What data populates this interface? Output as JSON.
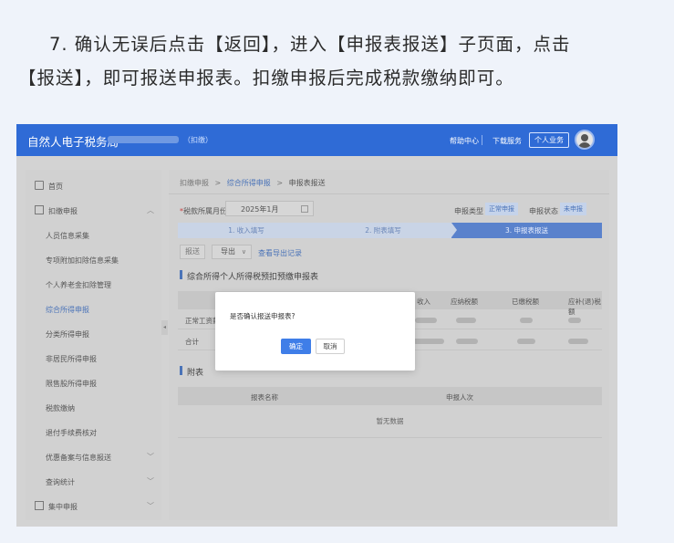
{
  "article": {
    "line1": "7. 确认无误后点击【返回】，进入【申报表报送】子页面，点击",
    "line2": "【报送】，即可报送申报表。扣缴申报后完成税款缴纳即可。"
  },
  "topbar": {
    "brand": "自然人电子税务局",
    "sub": "（扣缴）",
    "help": "帮助中心",
    "download": "下载服务",
    "business": "个人业务"
  },
  "sidebar": {
    "items": [
      {
        "label": "首页"
      },
      {
        "label": "扣缴申报"
      },
      {
        "label": "人员信息采集"
      },
      {
        "label": "专项附加扣除信息采集"
      },
      {
        "label": "个人养老金扣除管理"
      },
      {
        "label": "综合所得申报"
      },
      {
        "label": "分类所得申报"
      },
      {
        "label": "非居民所得申报"
      },
      {
        "label": "限售股所得申报"
      },
      {
        "label": "税款缴纳"
      },
      {
        "label": "退付手续费核对"
      },
      {
        "label": "优惠备案与信息报送"
      },
      {
        "label": "查询统计"
      },
      {
        "label": "集中申报"
      }
    ]
  },
  "breadcrumb": {
    "root": "扣缴申报",
    "sep1": ">",
    "mid": "综合所得申报",
    "sep2": ">",
    "current": "申报表报送"
  },
  "form": {
    "period_label": "税款所属月份",
    "period_value": "2025年1月",
    "type_label": "申报类型",
    "type_value": "正常申报",
    "status_label": "申报状态",
    "status_value": "未申报"
  },
  "steps": [
    {
      "label": "1. 收入填写"
    },
    {
      "label": "2. 附表填写"
    },
    {
      "label": "3. 申报表报送"
    }
  ],
  "toolbar": {
    "report": "报送",
    "export": "导出",
    "log": "查看导出记录"
  },
  "section1": {
    "title": "综合所得个人所得税预扣预缴申报表"
  },
  "table": {
    "headers": [
      "收入",
      "应纳税额",
      "已缴税额",
      "应补(退)税额"
    ],
    "row1_label": "正常工资薪金",
    "row2_label": "合计"
  },
  "section2": {
    "title": "附表"
  },
  "attachments": {
    "headers": [
      "报表名称",
      "申报人次"
    ],
    "empty": "暂无数据"
  },
  "modal": {
    "message": "是否确认报送申报表?",
    "ok": "确定",
    "cancel": "取消"
  },
  "colors": {
    "topbar": "#2f6bd6",
    "accent": "#3f7ee8",
    "overlay": "#d3d3d3"
  }
}
